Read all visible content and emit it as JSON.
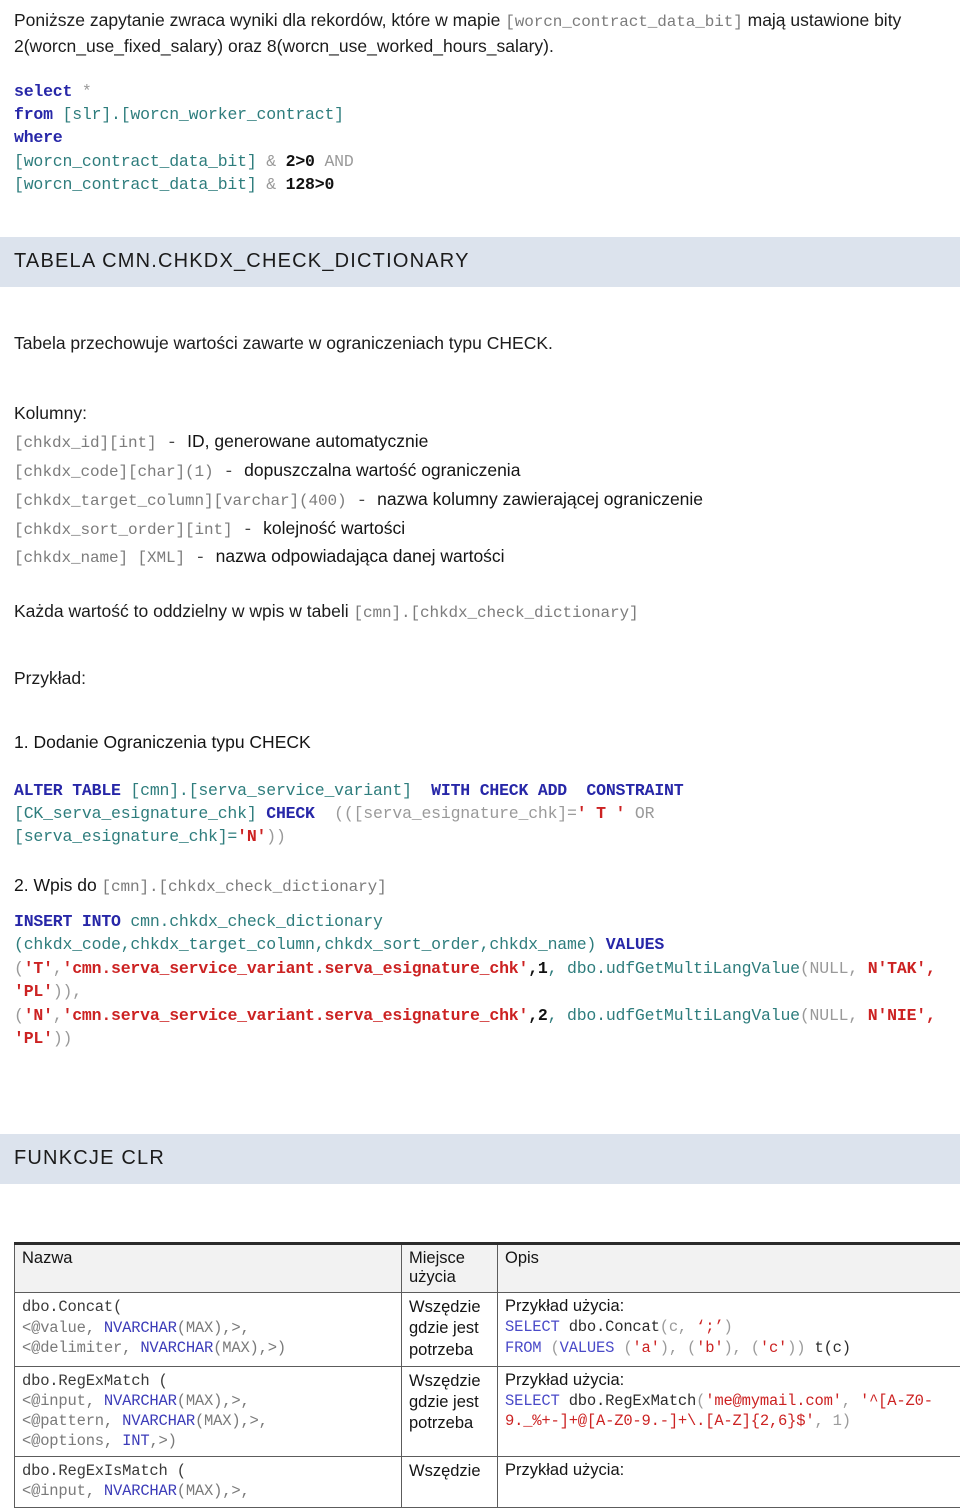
{
  "intro": {
    "text_before": "Poniższe zapytanie zwraca wyniki dla rekordów, które w mapie ",
    "code_inline": "[worcn_contract_data_bit]",
    "text_after": " mają ustawione bity 2(worcn_use_fixed_salary) oraz 8(worcn_use_worked_hours_salary)."
  },
  "query1": {
    "l1_kw": "select",
    "l1_op": " *",
    "l2_kw": "from ",
    "l2_ident": "[slr].[worcn_worker_contract]",
    "l3_kw": "where",
    "l4_ident": "[worcn_contract_data_bit]",
    "l4_op": " & ",
    "l4_num": "2>0",
    "l4_and": " AND",
    "l5_ident": "[worcn_contract_data_bit]",
    "l5_op": " & ",
    "l5_num": "128>0"
  },
  "section_table": {
    "banner_title": "TABELA CMN.CHKDX_CHECK_DICTIONARY",
    "description": "Tabela przechowuje wartości zawarte w ograniczeniach typu CHECK.",
    "columns_label": "Kolumny:",
    "columns": [
      {
        "def": "[chkdx_id][int]",
        "dash": "  -  ",
        "desc": "ID, generowane automatycznie"
      },
      {
        "def": "[chkdx_code][char](1)",
        "dash": " - ",
        "desc": "dopuszczalna wartość ograniczenia"
      },
      {
        "def": "[chkdx_target_column][varchar](400)",
        "dash": " - ",
        "desc": "nazwa kolumny zawierającej ograniczenie"
      },
      {
        "def": "[chkdx_sort_order][int]",
        "dash": " - ",
        "desc": "kolejność wartości"
      },
      {
        "def": "[chkdx_name] [XML]",
        "dash": " - ",
        "desc": "nazwa odpowiadająca danej wartości"
      }
    ],
    "note_text": "Każda wartość to oddzielny w wpis w tabeli ",
    "note_code": "[cmn].[chkdx_check_dictionary]",
    "example_label": "Przykład:",
    "step1_label": "1. Dodanie Ograniczenia typu CHECK",
    "alter": {
      "kw_alter": "ALTER TABLE ",
      "ident_table": "[cmn].[serva_service_variant]",
      "kw_with": "  WITH CHECK ADD  CONSTRAINT",
      "ident_ck": "[CK_serva_esignature_chk] ",
      "kw_check": "CHECK",
      "paren_open": "  (([serva_esignature_chk]=",
      "str_t": "' T '",
      "kw_or": " OR",
      "ident_chk2": "[serva_esignature_chk]=",
      "str_n": "'N'",
      "paren_close": "))"
    },
    "step2_label_a": "2. Wpis do ",
    "step2_label_code": "[cmn].[chkdx_check_dictionary]",
    "insert": {
      "kw_insert": "INSERT INTO ",
      "ident_target": "cmn.chkdx_check_dictionary",
      "cols": "(chkdx_code,chkdx_target_column,chkdx_sort_order,chkdx_name)",
      "kw_values": " VALUES",
      "row1_open": "(",
      "row1_str1": "'T'",
      "row1_comma": ",",
      "row1_str2": "'cmn.serva_service_variant.serva_esignature_chk'",
      "row1_num": ",1",
      "row1_fn": ", dbo.udfGetMultiLangValue",
      "row1_null": "(NULL, ",
      "row1_lang": "N'TAK', 'PL'",
      "row1_close": ")),",
      "row2_open": "(",
      "row2_str1": "'N'",
      "row2_comma": ",",
      "row2_str2": "'cmn.serva_service_variant.serva_esignature_chk'",
      "row2_num": ",2",
      "row2_fn": ", dbo.udfGetMultiLangValue",
      "row2_null": "(NULL, ",
      "row2_lang": "N'NIE', 'PL'",
      "row2_close": "))"
    }
  },
  "section_clr": {
    "banner_title": "FUNKCJE CLR",
    "table": {
      "headers": [
        "Nazwa",
        "Miejsce użycia",
        "Opis"
      ],
      "rows": [
        {
          "name_line1": "dbo.Concat(",
          "name_params": [
            {
              "angle": "<@value, ",
              "type": "NVARCHAR",
              "rest": "(MAX),>,"
            },
            {
              "angle": "<@delimiter, ",
              "type": "NVARCHAR",
              "rest": "(MAX),>)"
            }
          ],
          "place": "Wszędzie gdzie jest potrzeba",
          "desc_label": "Przykład użycia:",
          "code_lines": [
            [
              {
                "t": "SELECT",
                "c": "ckw"
              },
              {
                "t": " dbo.Concat",
                "c": "cplain"
              },
              {
                "t": "(c, ",
                "c": "cpar"
              },
              {
                "t": "‘;’",
                "c": "cstr"
              },
              {
                "t": ")",
                "c": "cpar"
              }
            ],
            [
              {
                "t": "FROM",
                "c": "ckw"
              },
              {
                "t": " (",
                "c": "cpar"
              },
              {
                "t": "VALUES",
                "c": "ckw"
              },
              {
                "t": " (",
                "c": "cpar"
              },
              {
                "t": "'a'",
                "c": "cstr"
              },
              {
                "t": "), (",
                "c": "cpar"
              },
              {
                "t": "'b'",
                "c": "cstr"
              },
              {
                "t": "), (",
                "c": "cpar"
              },
              {
                "t": "'c'",
                "c": "cstr"
              },
              {
                "t": ")) ",
                "c": "cpar"
              },
              {
                "t": "t(c)",
                "c": "cplain"
              }
            ]
          ]
        },
        {
          "name_line1": "dbo.RegExMatch (",
          "name_params": [
            {
              "angle": "<@input, ",
              "type": "NVARCHAR",
              "rest": "(MAX),>,"
            },
            {
              "angle": "<@pattern, ",
              "type": "NVARCHAR",
              "rest": "(MAX),>,"
            },
            {
              "angle": "<@options, ",
              "type": "INT",
              "rest": ",>)"
            }
          ],
          "place": "Wszędzie gdzie jest potrzeba",
          "desc_label": "Przykład użycia:",
          "code_lines": [
            [
              {
                "t": "SELECT",
                "c": "ckw"
              },
              {
                "t": " dbo.RegExMatch",
                "c": "cplain"
              },
              {
                "t": "(",
                "c": "cpar"
              },
              {
                "t": "'me@mymail.com'",
                "c": "cstr"
              },
              {
                "t": ", ",
                "c": "cpar"
              },
              {
                "t": "'^[A-Z0-9._%+-]+@[A-Z0-9.-]+\\.[A-Z]{2,6}$'",
                "c": "cstr"
              },
              {
                "t": ", 1)",
                "c": "cpar"
              }
            ]
          ]
        },
        {
          "name_line1": "dbo.RegExIsMatch (",
          "name_params": [
            {
              "angle": "<@input, ",
              "type": "NVARCHAR",
              "rest": "(MAX),>,"
            }
          ],
          "place": "Wszędzie",
          "desc_label": "Przykład użycia:",
          "code_lines": []
        }
      ]
    }
  },
  "colors": {
    "banner_bg": "#dce3ed",
    "keyword": "#2727a8",
    "identifier": "#2e7d7d",
    "string": "#cc2222",
    "operator": "#9a9a9a",
    "table_header_bg": "#f2f2f2",
    "table_border": "#5c5c5c"
  }
}
